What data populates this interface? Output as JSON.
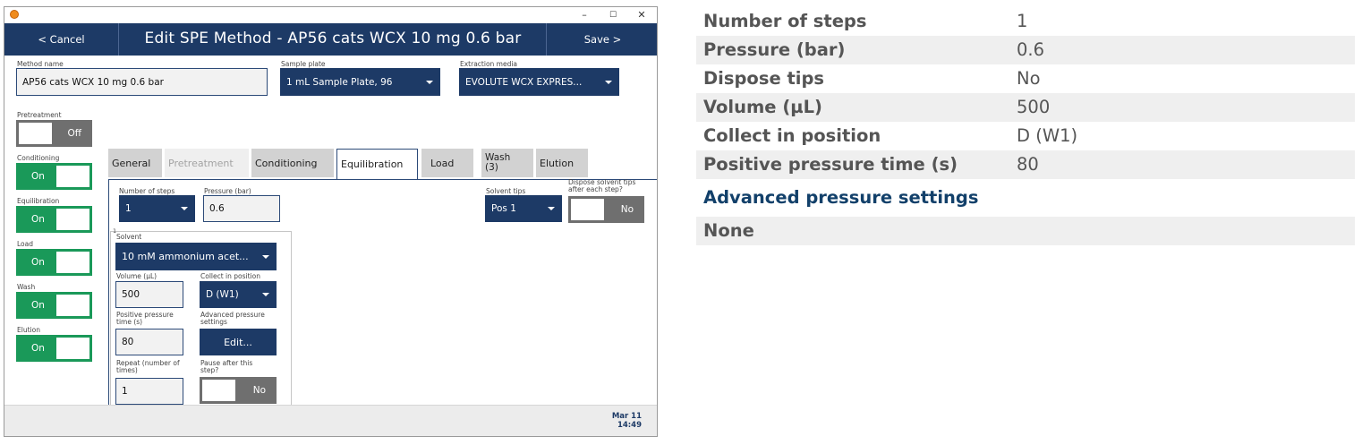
{
  "window": {
    "controls": [
      "–",
      "☐",
      "✕"
    ],
    "header": {
      "cancel_label": "< Cancel",
      "title": "Edit SPE Method - AP56 cats WCX 10 mg 0.6 bar",
      "save_label": "Save >"
    },
    "top_fields": {
      "method_name_label": "Method name",
      "method_name_value": "AP56 cats WCX 10 mg 0.6 bar",
      "sample_plate_label": "Sample plate",
      "sample_plate_value": "1 mL Sample Plate, 96",
      "extraction_media_label": "Extraction media",
      "extraction_media_value": "EVOLUTE WCX EXPRES..."
    },
    "step_toggles": [
      {
        "label": "Pretreatment",
        "state": "Off"
      },
      {
        "label": "Conditioning",
        "state": "On"
      },
      {
        "label": "Equilibration",
        "state": "On"
      },
      {
        "label": "Load",
        "state": "On"
      },
      {
        "label": "Wash",
        "state": "On"
      },
      {
        "label": "Elution",
        "state": "On"
      }
    ],
    "tabs": [
      {
        "label": "General"
      },
      {
        "label": "Pretreatment"
      },
      {
        "label": "Conditioning"
      },
      {
        "label": "Equilibration"
      },
      {
        "label": "Load"
      },
      {
        "label": "Wash\n(3)"
      },
      {
        "label": "Elution"
      }
    ],
    "active_tab": "Equilibration",
    "equilibration": {
      "num_steps_label": "Number of steps",
      "num_steps_value": "1",
      "pressure_label": "Pressure (bar)",
      "pressure_value": "0.6",
      "solvent_tips_label": "Solvent tips",
      "solvent_tips_value": "Pos 1",
      "dispose_label": "Dispose solvent tips after each step?",
      "dispose_value": "No",
      "step_number": "1",
      "solvent_label": "Solvent",
      "solvent_value": "10 mM ammonium acet...",
      "volume_label": "Volume (µL)",
      "volume_value": "500",
      "collect_label": "Collect in position",
      "collect_value": "D (W1)",
      "pp_time_label": "Positive pressure time (s)",
      "pp_time_value": "80",
      "adv_label": "Advanced pressure settings",
      "adv_button": "Edit...",
      "repeat_label": "Repeat (number of times)",
      "repeat_value": "1",
      "pause_label": "Pause after this step?",
      "pause_value": "No"
    },
    "footer": {
      "date": "Mar 11",
      "time": "14:49"
    }
  },
  "summary": {
    "rows": [
      {
        "key": "Number of steps",
        "value": "1"
      },
      {
        "key": "Pressure (bar)",
        "value": "0.6"
      },
      {
        "key": "Dispose tips",
        "value": "No"
      },
      {
        "key": "Volume (µL)",
        "value": "500"
      },
      {
        "key": "Collect in position",
        "value": "D (W1)"
      },
      {
        "key": "Positive pressure time (s)",
        "value": "80"
      }
    ],
    "advanced_heading": "Advanced pressure settings",
    "advanced_value": "None"
  },
  "colors": {
    "navy": "#1d3a66",
    "toggle_on": "#1a9959",
    "toggle_off": "#6f6f6f",
    "heading": "#12406a"
  }
}
